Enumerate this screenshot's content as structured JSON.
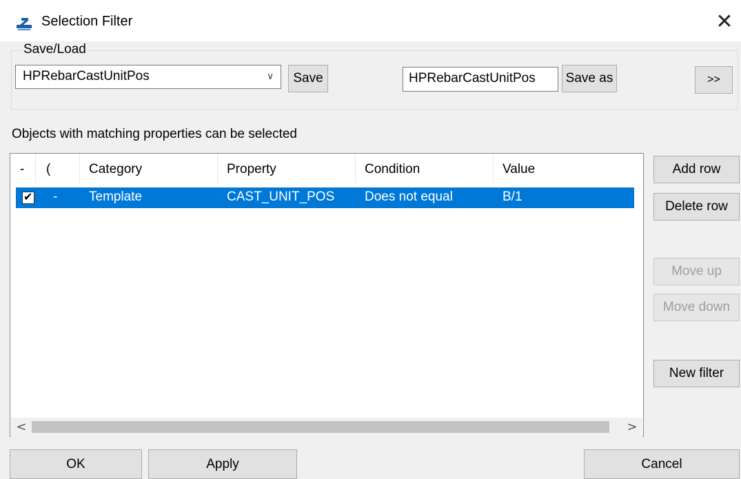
{
  "window": {
    "title": "Selection Filter",
    "app_icon": "selection-filter-app-icon",
    "close_glyph": "✕"
  },
  "save_load": {
    "legend": "Save/Load",
    "selected_filter": "HPRebarCastUnitPos",
    "save_label": "Save",
    "save_as_name": "HPRebarCastUnitPos",
    "save_as_label": "Save as",
    "expand_label": ">>"
  },
  "instructions": "Objects with matching properties can be selected",
  "table": {
    "columns": [
      "-",
      "(",
      "Category",
      "Property",
      "Condition",
      "Value"
    ],
    "rows": [
      {
        "checked": true,
        "paren": "-",
        "category": "Template",
        "property": "CAST_UNIT_POS",
        "condition": "Does not equal",
        "value": "B/1",
        "selected": true
      }
    ],
    "scroll_left": "<",
    "scroll_right": ">"
  },
  "side_buttons": {
    "add_row": "Add row",
    "delete_row": "Delete row",
    "move_up": "Move up",
    "move_down": "Move down",
    "new_filter": "New filter"
  },
  "footer": {
    "ok": "OK",
    "apply": "Apply",
    "cancel": "Cancel"
  },
  "colors": {
    "selection": "#0078d7",
    "window_bg": "#f0f0f0",
    "disabled_text": "#9e9e9e"
  }
}
